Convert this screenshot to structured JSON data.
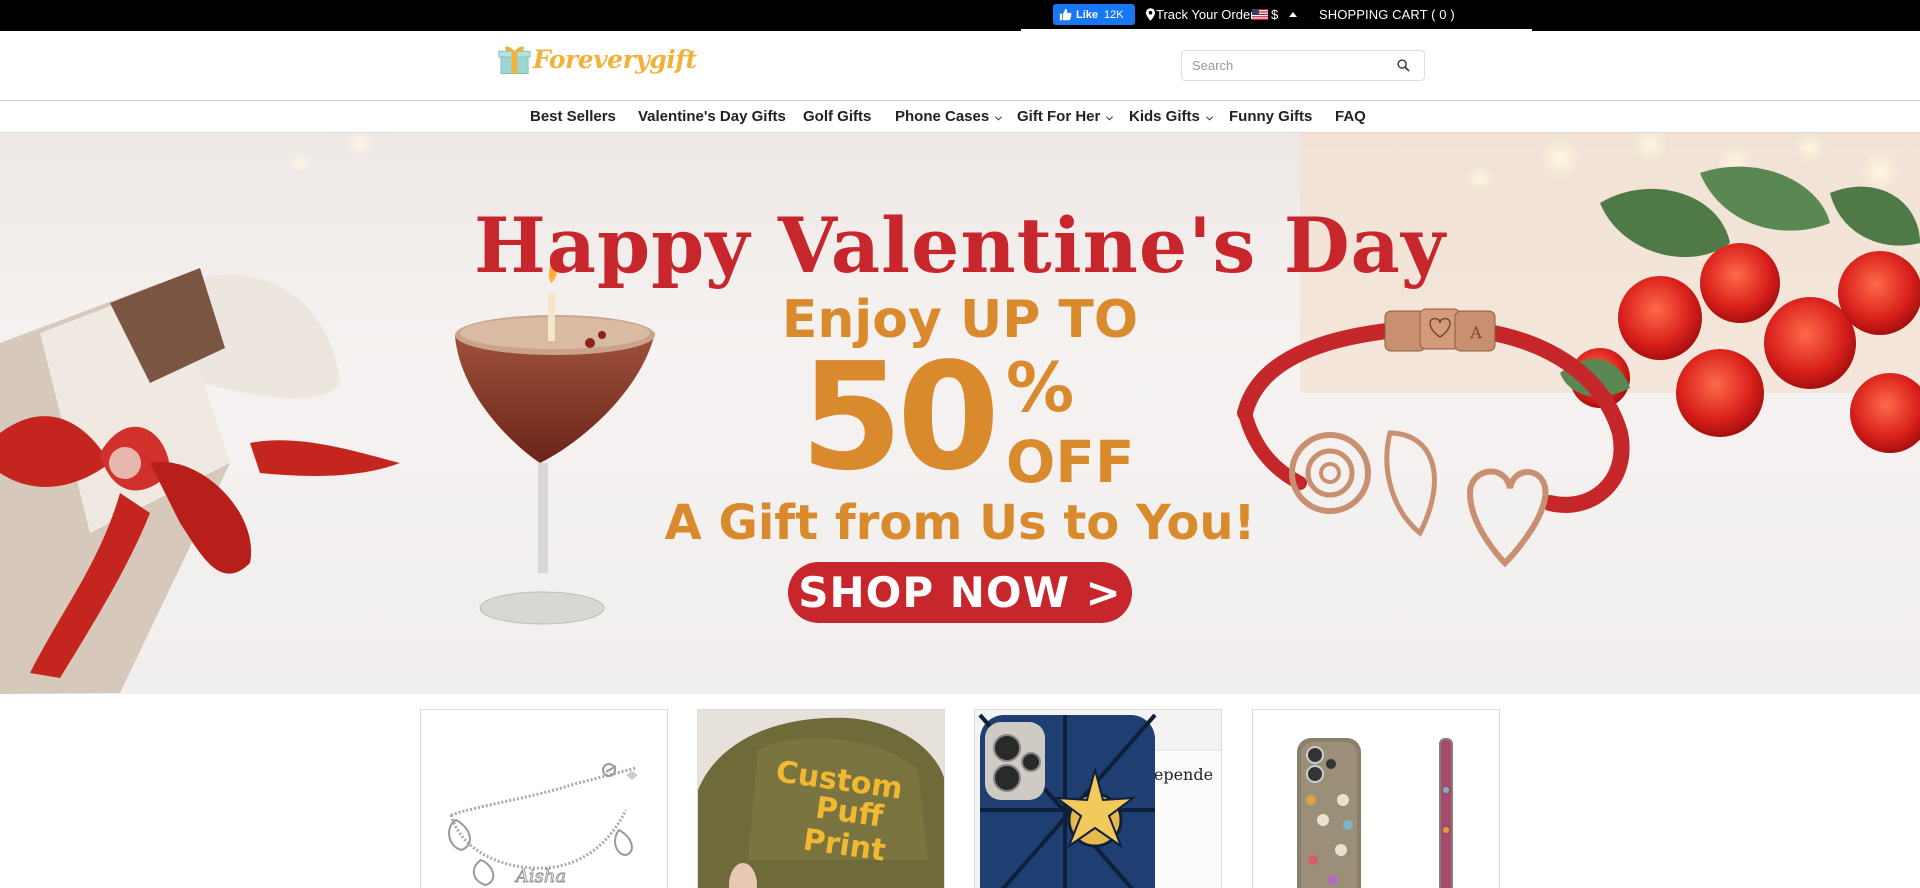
{
  "topbar": {
    "fb_like_label": "Like",
    "fb_like_count": "12K",
    "track_order": "Track Your Order",
    "currency": "$",
    "cart": "SHOPPING CART ( 0 )"
  },
  "header": {
    "logo_text": "Foreverygift",
    "search": {
      "placeholder": "Search",
      "value": ""
    }
  },
  "nav": {
    "items": [
      {
        "label": "Best Sellers",
        "dropdown": false
      },
      {
        "label": "Valentine's Day Gifts",
        "dropdown": false
      },
      {
        "label": "Golf Gifts",
        "dropdown": false
      },
      {
        "label": "Phone Cases",
        "dropdown": true
      },
      {
        "label": "Gift For Her",
        "dropdown": true
      },
      {
        "label": "Kids Gifts",
        "dropdown": true
      },
      {
        "label": "Funny Gifts",
        "dropdown": false
      },
      {
        "label": "FAQ",
        "dropdown": false
      }
    ]
  },
  "hero": {
    "title": "Happy Valentine's Day",
    "enjoy": "Enjoy UP TO",
    "percent_number": "50",
    "percent_sign": "%",
    "off": "OFF",
    "subtitle": "A Gift from Us to You!",
    "cta": "SHOP NOW >",
    "bracelet_letters": [
      "",
      "",
      "A"
    ]
  },
  "products": {
    "hat_text": [
      "Custom",
      "Puff",
      "Print"
    ],
    "case_text": "Independe"
  },
  "colors": {
    "brand_gold": "#f2b23a",
    "hero_red": "#c8262d",
    "hero_orange": "#d98a2c",
    "fb_blue": "#1877f2"
  }
}
